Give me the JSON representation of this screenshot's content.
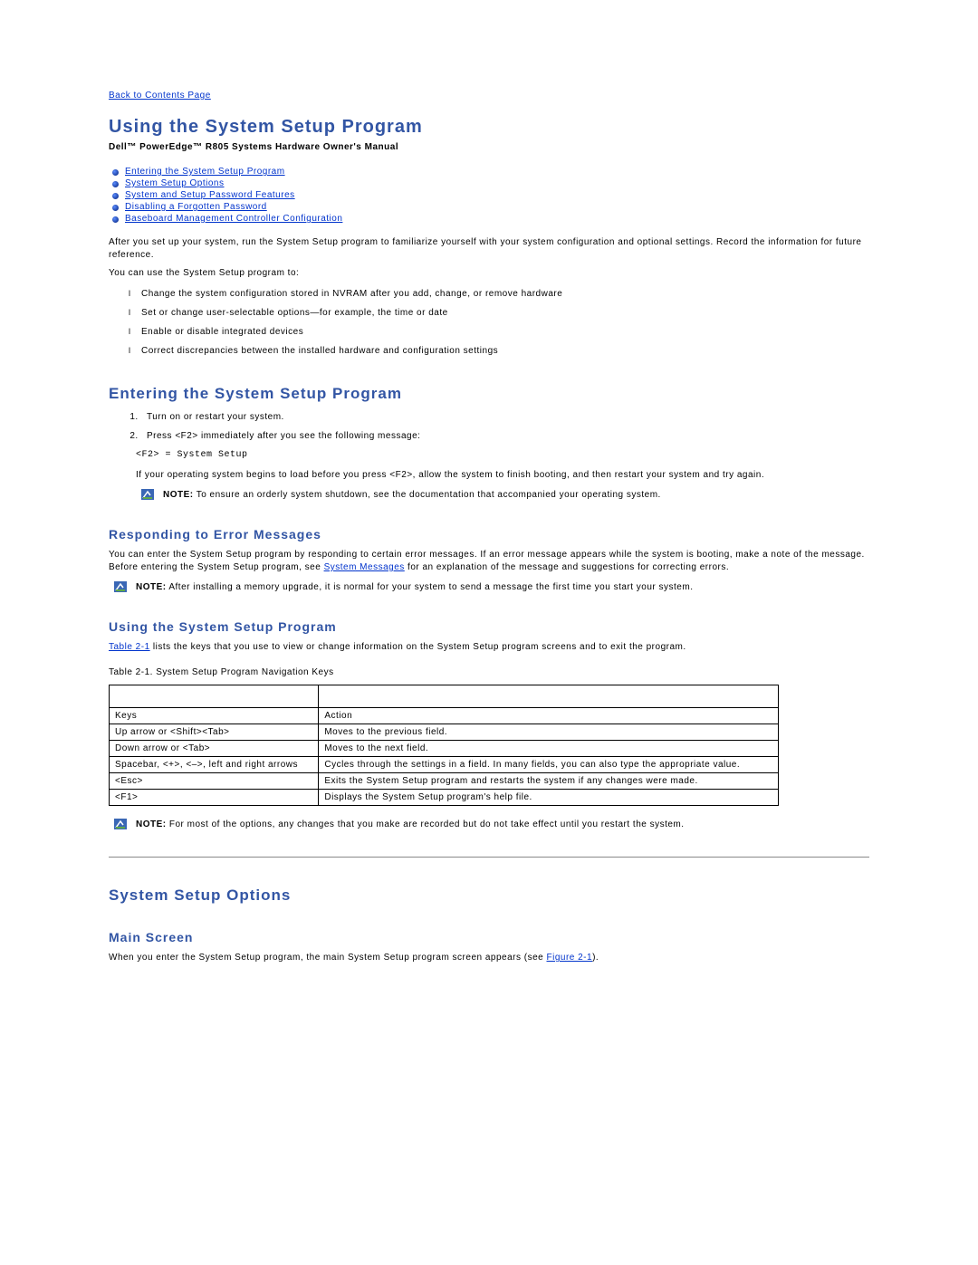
{
  "back_link": "Back to Contents Page",
  "page_title": "Using the System Setup Program",
  "subtitle": "Dell™ PowerEdge™ R805 Systems Hardware Owner's Manual",
  "toc": [
    "Entering the System Setup Program",
    "System Setup Options",
    "System and Setup Password Features",
    "Disabling a Forgotten Password",
    "Baseboard Management Controller Configuration"
  ],
  "intro_p1": "After you set up your system, run the System Setup program to familiarize yourself with your system configuration and optional settings. Record the information for future reference.",
  "intro_p2": "You can use the System Setup program to:",
  "intro_list": [
    "Change the system configuration stored in NVRAM after you add, change, or remove hardware",
    "Set or change user-selectable options—for example, the time or date",
    "Enable or disable integrated devices",
    "Correct discrepancies between the installed hardware and configuration settings"
  ],
  "entering": {
    "heading": "Entering the System Setup Program",
    "steps": [
      "Turn on or restart your system.",
      "Press <F2> immediately after you see the following message:"
    ],
    "code": "<F2> = System Setup",
    "after_code": "If your operating system begins to load before you press <F2>, allow the system to finish booting, and then restart your system and try again.",
    "note_label": "NOTE:",
    "note_text": " To ensure an orderly system shutdown, see the documentation that accompanied your operating system."
  },
  "responding": {
    "heading": "Responding to Error Messages",
    "p_before": "You can enter the System Setup program by responding to certain error messages. If an error message appears while the system is booting, make a note of the message. Before entering the System Setup program, see ",
    "link": "System Messages",
    "p_after": " for an explanation of the message and suggestions for correcting errors.",
    "note_label": "NOTE:",
    "note_text": " After installing a memory upgrade, it is normal for your system to send a message the first time you start your system."
  },
  "using": {
    "heading": "Using the System Setup Program",
    "p_link": "Table 2-1",
    "p_after": " lists the keys that you use to view or change information on the System Setup program screens and to exit the program.",
    "table_caption": "Table 2-1. System Setup Program Navigation Keys",
    "table_headers": {
      "keys": "Keys",
      "action": "Action"
    },
    "table_rows": [
      {
        "keys": "Up arrow or <Shift><Tab>",
        "action": "Moves to the previous field."
      },
      {
        "keys": "Down arrow or <Tab>",
        "action": "Moves to the next field."
      },
      {
        "keys": "Spacebar, <+>, <–>, left and right arrows",
        "action": "Cycles through the settings in a field. In many fields, you can also type the appropriate value."
      },
      {
        "keys": "<Esc>",
        "action": "Exits the System Setup program and restarts the system if any changes were made."
      },
      {
        "keys": "<F1>",
        "action": "Displays the System Setup program's help file."
      }
    ],
    "note_label": "NOTE:",
    "note_text": " For most of the options, any changes that you make are recorded but do not take effect until you restart the system."
  },
  "options": {
    "heading": "System Setup Options",
    "main_screen": "Main Screen",
    "p_before": "When you enter the System Setup program, the main System Setup program screen appears (see ",
    "link": "Figure 2-1",
    "p_after": ")."
  }
}
